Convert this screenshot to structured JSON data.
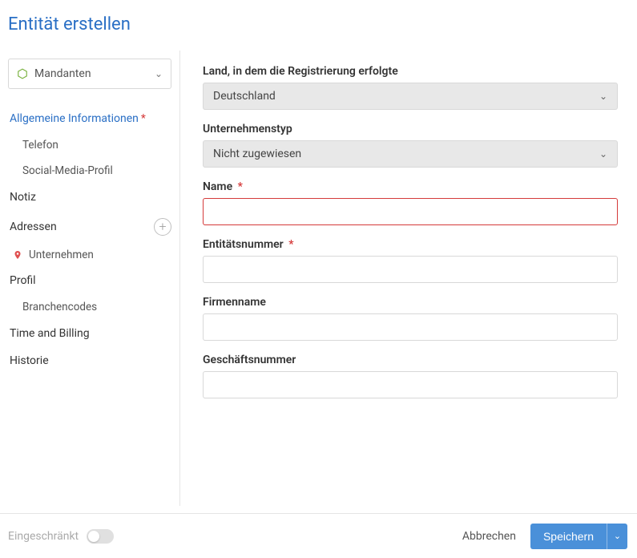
{
  "page": {
    "title": "Entität erstellen"
  },
  "sidebar": {
    "mandanten": {
      "label": "Mandanten"
    },
    "items": {
      "general": {
        "label": "Allgemeine Informationen",
        "required": "*"
      },
      "telefon": {
        "label": "Telefon"
      },
      "social": {
        "label": "Social-Media-Profil"
      },
      "notiz": {
        "label": "Notiz"
      },
      "adressen": {
        "label": "Adressen"
      },
      "unternehmen": {
        "label": "Unternehmen"
      },
      "profil": {
        "label": "Profil"
      },
      "branchen": {
        "label": "Branchencodes"
      },
      "time": {
        "label": "Time and Billing"
      },
      "historie": {
        "label": "Historie"
      }
    }
  },
  "form": {
    "country": {
      "label": "Land, in dem die Registrierung erfolgte",
      "value": "Deutschland"
    },
    "company_type": {
      "label": "Unternehmenstyp",
      "value": "Nicht zugewiesen"
    },
    "name": {
      "label": "Name",
      "required": "*",
      "value": ""
    },
    "entity_number": {
      "label": "Entitätsnummer",
      "required": "*",
      "value": ""
    },
    "firm_name": {
      "label": "Firmenname",
      "value": ""
    },
    "business_number": {
      "label": "Geschäftsnummer",
      "value": ""
    }
  },
  "footer": {
    "restricted": "Eingeschränkt",
    "cancel": "Abbrechen",
    "save": "Speichern"
  }
}
